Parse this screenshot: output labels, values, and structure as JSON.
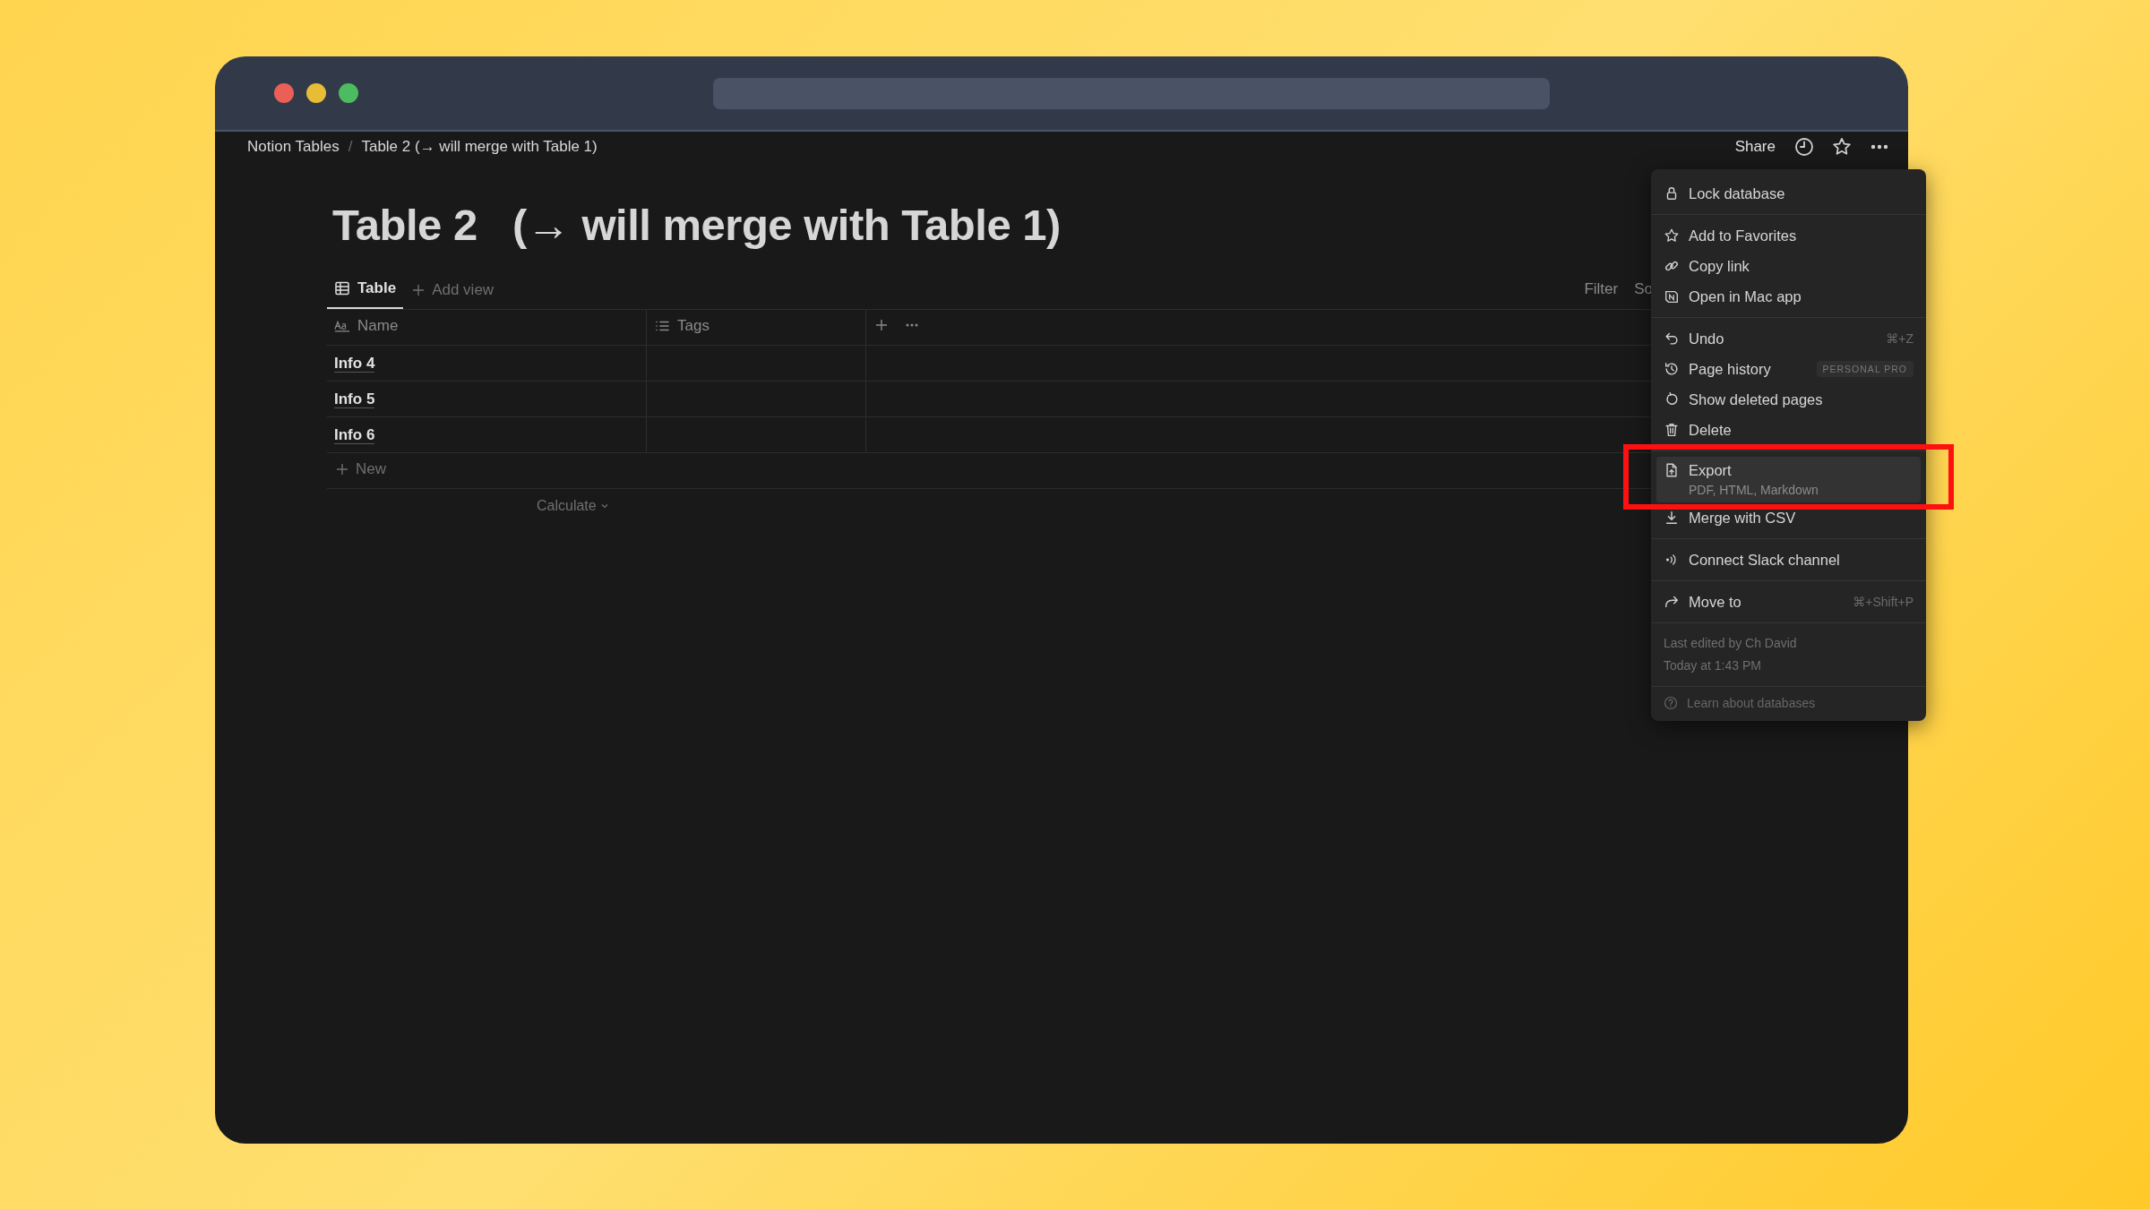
{
  "breadcrumb_separator": "/",
  "breadcrumbs": [
    {
      "label": "Notion Tables"
    },
    {
      "label": "Table 2 (→ will merge with Table 1)"
    }
  ],
  "topbar": {
    "share": "Share"
  },
  "title": "Table 2   (→ will merge with Table 1)",
  "view_tabs": [
    {
      "label": "Table",
      "selected": true
    }
  ],
  "add_view": "Add view",
  "toolbar": [
    "Filter",
    "So"
  ],
  "table": {
    "columns": [
      {
        "label": "Name",
        "kind": "title"
      },
      {
        "label": "Tags",
        "kind": "multi"
      }
    ],
    "rows": [
      {
        "name": "Info 4"
      },
      {
        "name": "Info 5"
      },
      {
        "name": "Info 6"
      }
    ],
    "new_row": "New",
    "calculate": "Calculate"
  },
  "menu": {
    "sections": [
      {
        "items": [
          {
            "label": "Lock database",
            "kind": "lock",
            "highlighted": false,
            "annotated": false
          }
        ]
      },
      {
        "items": [
          {
            "label": "Add to Favorites",
            "kind": "star",
            "highlighted": false,
            "annotated": false
          },
          {
            "label": "Copy link",
            "kind": "link",
            "highlighted": false,
            "annotated": false
          },
          {
            "label": "Open in Mac app",
            "kind": "app",
            "highlighted": false,
            "annotated": false
          }
        ]
      },
      {
        "items": [
          {
            "label": "Undo",
            "kind": "undo",
            "shortcut": "⌘+Z",
            "highlighted": false,
            "annotated": false
          },
          {
            "label": "Page history",
            "kind": "history",
            "badge": "PERSONAL PRO",
            "highlighted": false,
            "annotated": false
          },
          {
            "label": "Show deleted pages",
            "kind": "restore",
            "highlighted": false,
            "annotated": false
          },
          {
            "label": "Delete",
            "kind": "trash",
            "highlighted": false,
            "annotated": false
          }
        ]
      },
      {
        "items": [
          {
            "label": "Export",
            "kind": "export",
            "subtitle": "PDF, HTML, Markdown",
            "highlighted": true,
            "annotated": true
          },
          {
            "label": "Merge with CSV",
            "kind": "import",
            "highlighted": false,
            "annotated": false
          }
        ]
      },
      {
        "items": [
          {
            "label": "Connect Slack channel",
            "kind": "broadcast",
            "highlighted": false,
            "annotated": false
          }
        ]
      },
      {
        "items": [
          {
            "label": "Move to",
            "kind": "move",
            "shortcut": "⌘+Shift+P",
            "highlighted": false,
            "annotated": false
          }
        ]
      }
    ],
    "footer": [
      "Last edited by Ch David",
      "Today at 1:43 PM"
    ],
    "help": "Learn about databases"
  }
}
